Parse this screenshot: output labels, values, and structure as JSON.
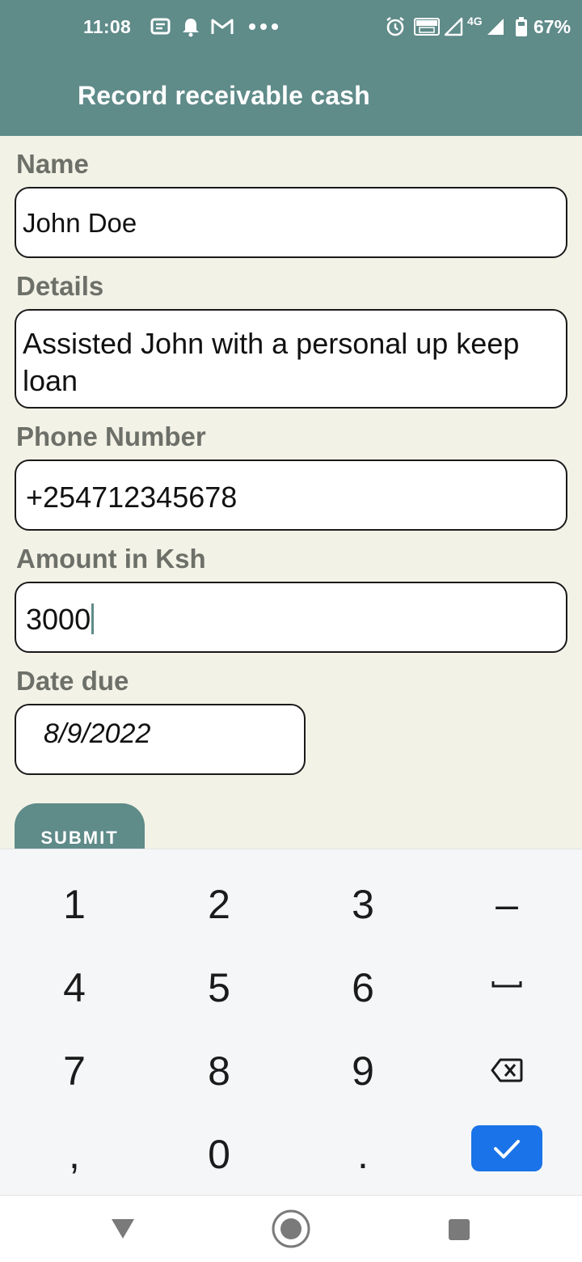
{
  "status_bar": {
    "time": "11:08",
    "battery": "67%",
    "network": "4G",
    "left_icons": [
      "message-icon",
      "notification-bell-icon",
      "gmail-icon",
      "more-dots-icon"
    ],
    "right_icons": [
      "alarm-icon",
      "volte-icon",
      "signal-icon",
      "signal-icon",
      "battery-icon"
    ]
  },
  "app_bar": {
    "title": "Record receivable cash"
  },
  "form": {
    "name_label": "Name",
    "name_value": "John Doe",
    "details_label": "Details",
    "details_value": "Assisted John with a personal up keep loan",
    "phone_label": "Phone Number",
    "phone_value": "+254712345678",
    "amount_label": "Amount in Ksh",
    "amount_value": "3000",
    "date_label": "Date due",
    "date_value": "8/9/2022",
    "submit_label": "SUBMIT"
  },
  "keyboard": {
    "keys": [
      "1",
      "2",
      "3",
      "–",
      "4",
      "5",
      "6",
      "␣",
      "7",
      "8",
      "9",
      "⌫",
      ",",
      "0",
      ".",
      "✓"
    ]
  },
  "colors": {
    "accent": "#5f8b89",
    "background": "#f3f2e7",
    "keyboard_enter": "#1a73e8"
  }
}
